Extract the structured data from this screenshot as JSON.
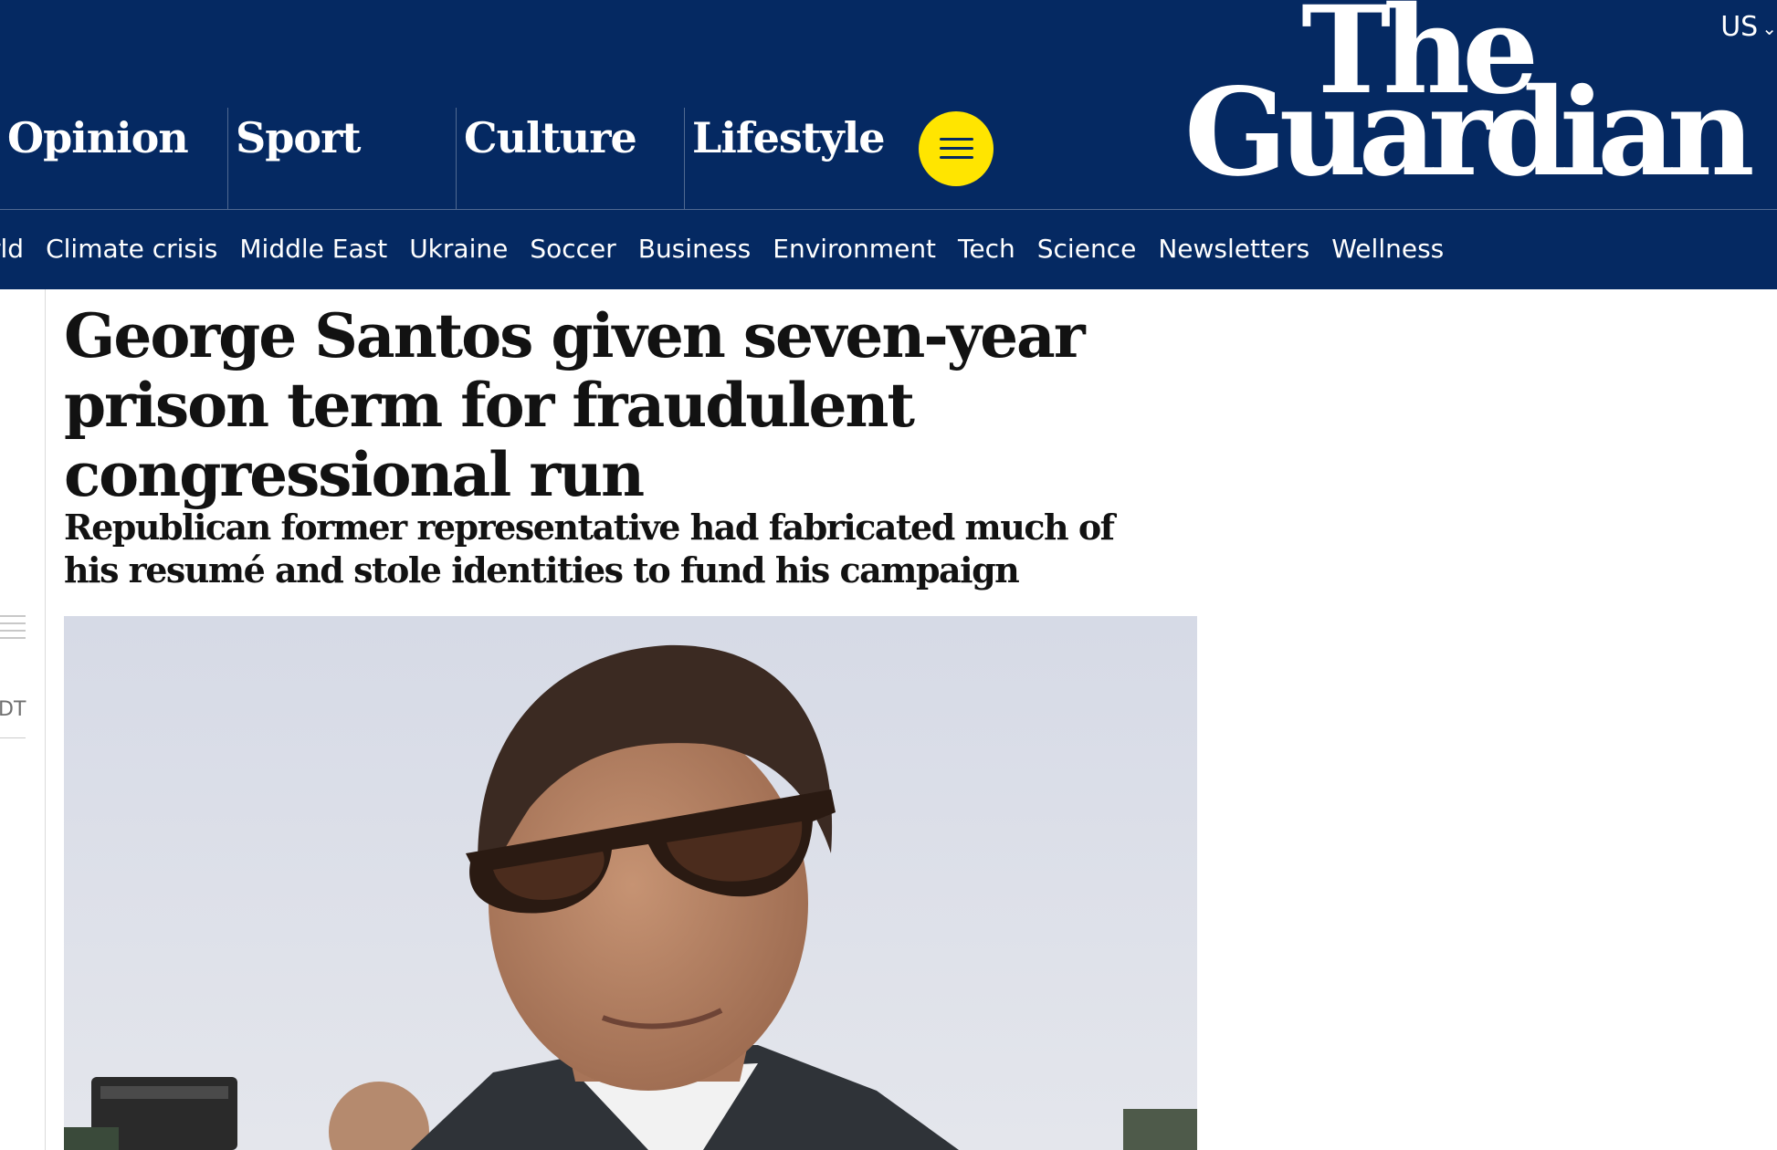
{
  "header": {
    "edition": "US",
    "logo": {
      "line1": "The",
      "line2": "Guardian"
    },
    "pillars": [
      "Opinion",
      "Sport",
      "Culture",
      "Lifestyle"
    ],
    "subnav": [
      "rld",
      "Climate crisis",
      "Middle East",
      "Ukraine",
      "Soccer",
      "Business",
      "Environment",
      "Tech",
      "Science",
      "Newsletters",
      "Wellness"
    ]
  },
  "rail": {
    "timestamp": "DT"
  },
  "article": {
    "headline": "George Santos given seven-year prison term for fraudulent congressional run",
    "standfirst": "Republican former representative had fabricated much of his resumé and stole identities to fund his campaign"
  },
  "colors": {
    "brand_navy": "#052962",
    "menu_yellow": "#ffe500",
    "text": "#121212"
  },
  "icons": {
    "menu": "hamburger-menu-icon",
    "edition_chevron": "chevron-down-icon",
    "rail_lines": "lines-icon"
  }
}
